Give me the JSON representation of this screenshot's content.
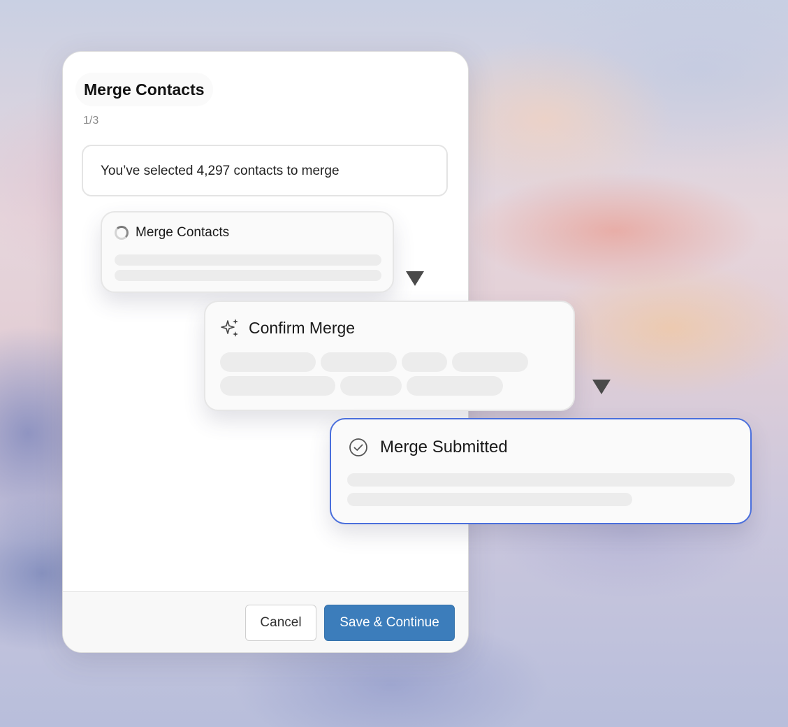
{
  "modal": {
    "title": "Merge Contacts",
    "step": "1/3",
    "summary": "You’ve selected 4,297 contacts to merge",
    "cancel_label": "Cancel",
    "save_label": "Save & Continue"
  },
  "steps": [
    {
      "title": "Merge Contacts",
      "icon": "loading-spinner-icon",
      "state": "in-progress"
    },
    {
      "title": "Confirm Merge",
      "icon": "sparkle-icon",
      "state": "pending"
    },
    {
      "title": "Merge Submitted",
      "icon": "check-circle-icon",
      "state": "active"
    }
  ],
  "colors": {
    "primary_button": "#3c7dbb",
    "active_border": "#4a6fdc",
    "skeleton": "#ececec"
  }
}
